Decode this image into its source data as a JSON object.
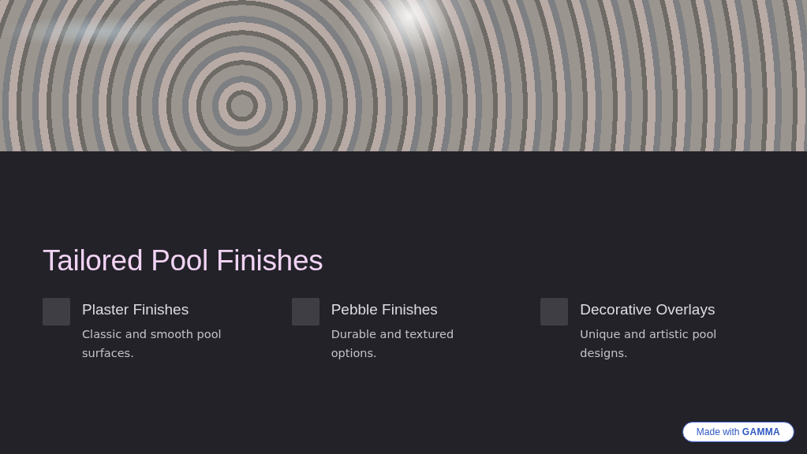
{
  "title": "Tailored Pool Finishes",
  "cards": [
    {
      "heading": "Plaster Finishes",
      "description": "Classic and smooth pool surfaces."
    },
    {
      "heading": "Pebble Finishes",
      "description": "Durable and textured options."
    },
    {
      "heading": "Decorative Overlays",
      "description": "Unique and artistic pool designs."
    }
  ],
  "badge": "Made with **GAMMA**"
}
